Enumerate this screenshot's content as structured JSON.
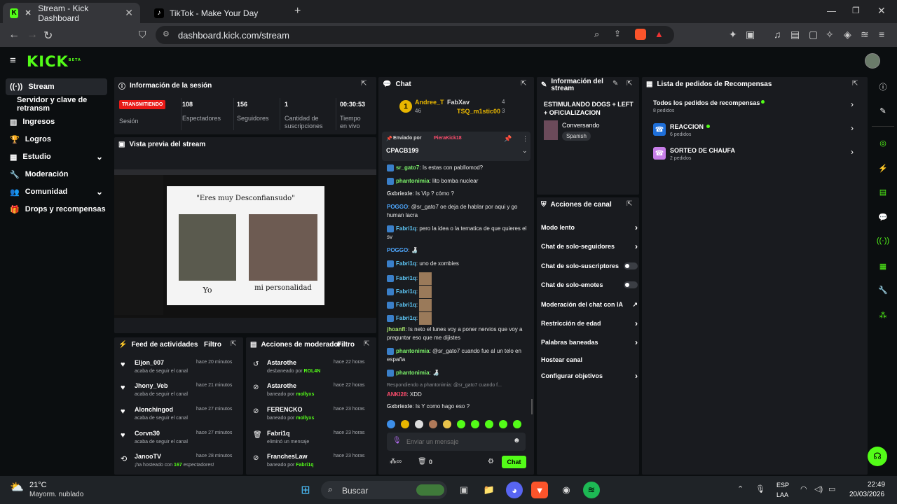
{
  "browser": {
    "tabs": [
      {
        "title": "Stream - Kick Dashboard"
      },
      {
        "title": "TikTok - Make Your Day"
      }
    ],
    "url": "dashboard.kick.com/stream"
  },
  "app": {
    "logo": "KICK",
    "beta": "BETA"
  },
  "sidebar": {
    "items": [
      {
        "label": "Stream",
        "icon": "broadcast-icon"
      },
      {
        "label": "Servidor y clave de retransm"
      },
      {
        "label": "Ingresos",
        "icon": "chart-icon"
      },
      {
        "label": "Logros",
        "icon": "trophy-icon"
      },
      {
        "label": "Estudio",
        "icon": "studio-icon"
      },
      {
        "label": "Moderación",
        "icon": "wrench-icon"
      },
      {
        "label": "Comunidad",
        "icon": "people-icon"
      },
      {
        "label": "Drops y recompensas",
        "icon": "gift-icon"
      }
    ]
  },
  "session": {
    "title": "Información de la sesión",
    "status": "TRANSMITIENDO",
    "status_label": "Sesión",
    "stats": [
      {
        "value": "108",
        "label": "Espectadores"
      },
      {
        "value": "156",
        "label": "Seguidores"
      },
      {
        "value": "1",
        "label": "Cantidad de suscripciones"
      },
      {
        "value": "00:30:53",
        "label": "Tiempo en vivo"
      }
    ]
  },
  "preview": {
    "title": "Vista previa del stream",
    "meme_title": "\"Eres muy Desconfiansudo\"",
    "caption_left": "Yo",
    "caption_right": "mi personalidad"
  },
  "feed": {
    "title": "Feed de actividades",
    "filter": "Filtro",
    "rows": [
      {
        "name": "Eljon_007",
        "time": "hace 20 minutos",
        "action": "acaba de seguir el canal"
      },
      {
        "name": "Jhony_Veb",
        "time": "hace 21 minutos",
        "action": "acaba de seguir el canal"
      },
      {
        "name": "Alonchingod",
        "time": "hace 27 minutos",
        "action": "acaba de seguir el canal"
      },
      {
        "name": "Corvn30",
        "time": "hace 27 minutos",
        "action": "acaba de seguir el canal"
      },
      {
        "name": "JanooTV",
        "time": "hace 28 minutos",
        "action_pre": "¡ha hosteado con ",
        "count": "167",
        "action_post": " espectadores!"
      }
    ]
  },
  "modactions": {
    "title": "Acciones de moderador",
    "filter": "Filtro",
    "rows": [
      {
        "name": "Astarothe",
        "time": "hace 22 horas",
        "action": "desbaneado por ",
        "by": "ROL4N"
      },
      {
        "name": "Astarothe",
        "time": "hace 22 horas",
        "action": "baneado por ",
        "by": "mollyxs"
      },
      {
        "name": "FERENCKO",
        "time": "hace 23 horas",
        "action": "baneado por ",
        "by": "mollyxs"
      },
      {
        "name": "Fabri1q",
        "time": "hace 23 horas",
        "action": "eliminó un mensaje",
        "by": ""
      },
      {
        "name": "FranchesLaw",
        "time": "hace 23 horas",
        "action": "baneado por ",
        "by": "Fabri1q"
      }
    ]
  },
  "chat": {
    "title": "Chat",
    "top": [
      {
        "rank": "1",
        "name": "Andree_T",
        "count": "46"
      },
      {
        "name": "FabXav",
        "count": "4"
      },
      {
        "name": "TSQ_m1stic00",
        "count": "3"
      }
    ],
    "pinned_label": "Enviado por",
    "pinned_user": "PieraKick18",
    "pinned_msg": "CPACB199",
    "messages": [
      {
        "user": "sr_gato7",
        "color": "#7cf26a",
        "text": "Is estas con pabllomod?"
      },
      {
        "user": "phantonimia",
        "color": "#7cf26a",
        "text": "lito bomba nuclear"
      },
      {
        "user": "Gxbriexle",
        "color": "#d8d8d8",
        "text": "Is Vip ? cómo ?"
      },
      {
        "user": "POGGO",
        "color": "#4fa8ff",
        "text": "@sr_gato7 oe deja de hablar por aqui y go human lacra"
      },
      {
        "user": "Fabri1q",
        "color": "#5ec7f7",
        "text": "pero la idea o la tematica de que quieres el sv"
      },
      {
        "user": "POGGO",
        "color": "#4fa8ff",
        "text": "🍶"
      },
      {
        "user": "Fabri1q",
        "color": "#5ec7f7",
        "text": "uno de xombies"
      },
      {
        "user": "Fabri1q",
        "color": "#5ec7f7",
        "text": ""
      },
      {
        "user": "Fabri1q",
        "color": "#5ec7f7",
        "text": ""
      },
      {
        "user": "Fabri1q",
        "color": "#5ec7f7",
        "text": ""
      },
      {
        "user": "Fabri1q",
        "color": "#5ec7f7",
        "text": ""
      },
      {
        "user": "jhoanfl",
        "color": "#a6e36b",
        "text": "Is neto el lunes voy a poner nervios que voy a preguntar eso que me dijistes"
      },
      {
        "user": "phantonimia",
        "color": "#7cf26a",
        "text": "@sr_gato7 cuando fue al un telo en españa"
      },
      {
        "user": "phantonimia",
        "color": "#7cf26a",
        "text": "🍶"
      },
      {
        "user": "ANKI28",
        "color": "#ff4d6d",
        "text": "XDD",
        "reply": "Respondiendo a phantonimia: @sr_gato7 cuando f..."
      },
      {
        "user": "Gxbriexle",
        "color": "#d8d8d8",
        "text": "Is Y como hago eso ?"
      }
    ],
    "placeholder": "Enviar un mensaje",
    "points": "0",
    "send": "Chat"
  },
  "streaminfo": {
    "title": "Información del stream",
    "stream_title": "ESTIMULANDO DOGS + LEFT + OFICIALIZACION",
    "category": "Conversando",
    "language": "Spanish"
  },
  "channelactions": {
    "title": "Acciones de canal",
    "items": [
      {
        "label": "Modo lento",
        "kind": "chevron"
      },
      {
        "label": "Chat de solo-seguidores",
        "kind": "chevron"
      },
      {
        "label": "Chat de solo-suscriptores",
        "kind": "toggle"
      },
      {
        "label": "Chat de solo-emotes",
        "kind": "toggle"
      },
      {
        "label": "Moderación del chat con IA",
        "kind": "external"
      },
      {
        "label": "Restricción de edad",
        "kind": "chevron"
      },
      {
        "label": "Palabras baneadas",
        "kind": "chevron"
      },
      {
        "label": "Hostear canal",
        "kind": "none"
      },
      {
        "label": "Configurar objetivos",
        "kind": "chevron"
      }
    ]
  },
  "rewards": {
    "title": "Lista de pedidos de Recompensas",
    "all_label": "Todos los pedidos de recompensas",
    "all_count": "8 pedidos",
    "items": [
      {
        "name": "REACCION",
        "count": "6 pedidos",
        "color": "#1e6fd9"
      },
      {
        "name": "SORTEO DE CHAUFA",
        "count": "2 pedidos",
        "color": "#c77ee8"
      }
    ]
  },
  "taskbar": {
    "temp": "21°C",
    "weather": "Mayorm. nublado",
    "search": "Buscar",
    "lang1": "ESP",
    "lang2": "LAA",
    "time": "22:49",
    "date": "20/03/2026"
  },
  "colors": {
    "accent": "#53fc18",
    "live": "#e91916",
    "panel": "#191b1f"
  }
}
